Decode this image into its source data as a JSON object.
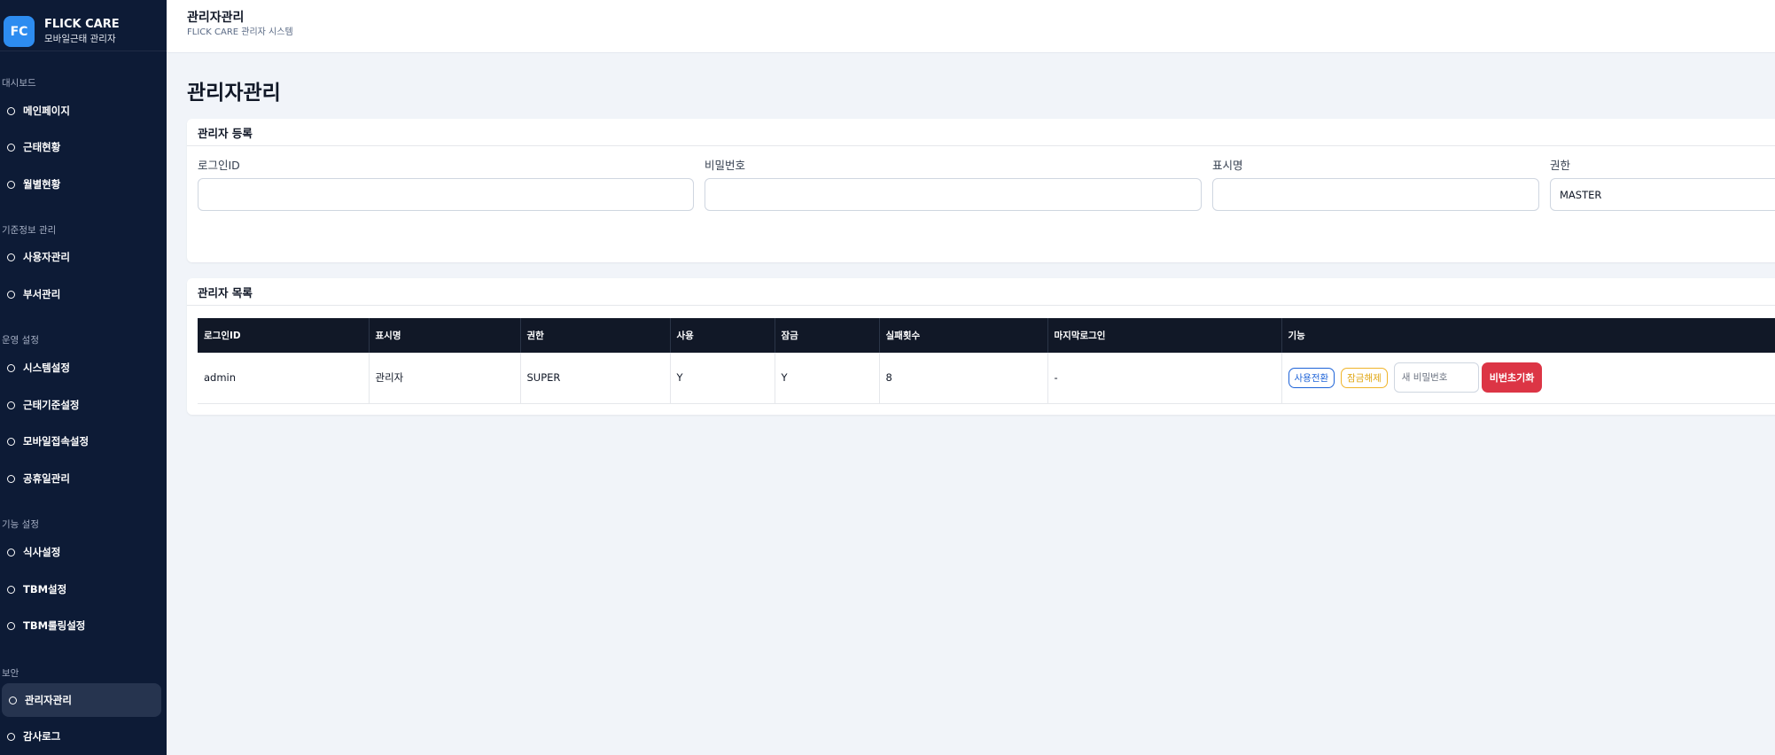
{
  "brand": {
    "logo": "FC",
    "title": "FLICK CARE",
    "subtitle": "모바일근태 관리자"
  },
  "sidebar": {
    "sections": [
      {
        "label": "대시보드",
        "items": [
          "메인페이지",
          "근태현황",
          "월별현황"
        ]
      },
      {
        "label": "기준정보 관리",
        "items": [
          "사용자관리",
          "부서관리"
        ]
      },
      {
        "label": "운영 설정",
        "items": [
          "시스템설정",
          "근태기준설정",
          "모바일접속설정",
          "공휴일관리"
        ]
      },
      {
        "label": "기능 설정",
        "items": [
          "식사설정",
          "TBM설정",
          "TBM룰링설정"
        ]
      },
      {
        "label": "보안",
        "items": [
          "관리자관리",
          "감사로그"
        ]
      }
    ],
    "active_item": "관리자관리"
  },
  "topbar": {
    "title": "관리자관리",
    "subtitle": "FLICK CARE 관리자 시스템"
  },
  "page": {
    "title": "관리자관리"
  },
  "register": {
    "header": "관리자 등록",
    "fields": {
      "login_id": {
        "label": "로그인ID",
        "value": ""
      },
      "password": {
        "label": "비밀번호",
        "value": ""
      },
      "display_name": {
        "label": "표시명",
        "value": ""
      },
      "role": {
        "label": "권한",
        "value": "MASTER"
      }
    }
  },
  "list": {
    "header": "관리자 목록",
    "columns": [
      "로그인ID",
      "표시명",
      "권한",
      "사용",
      "잠금",
      "실패횟수",
      "마지막로그인",
      "기능"
    ],
    "rows": [
      {
        "login_id": "admin",
        "display_name": "관리자",
        "role": "SUPER",
        "use": "Y",
        "lock": "Y",
        "fail_count": "8",
        "last_login": "-"
      }
    ],
    "actions": {
      "toggle_use": "사용전환",
      "unlock": "잠금해제",
      "new_password_placeholder": "새 비밀번호",
      "reset_password": "비번초기화"
    }
  },
  "colors": {
    "sidebar_bg": "#0d1b36",
    "brand_accent": "#2d8cf0",
    "table_header": "#111827",
    "danger": "#dc3545",
    "primary": "#1d63d8",
    "warning": "#f0b429"
  }
}
